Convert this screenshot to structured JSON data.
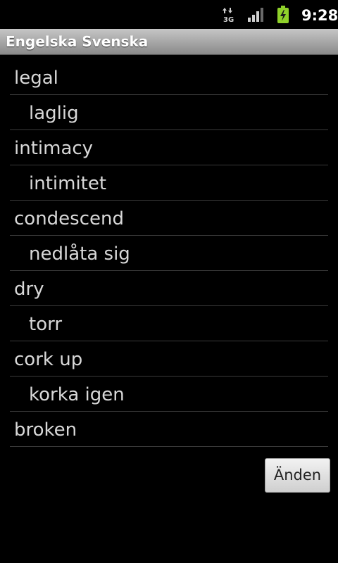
{
  "status_bar": {
    "network_label": "3G",
    "network_icon": "3g-data-icon",
    "signal_icon": "signal-strength-icon",
    "battery_icon": "battery-charging-icon",
    "time": "9:28"
  },
  "title_bar": {
    "title": "Engelska Svenska"
  },
  "word_list": {
    "items": [
      {
        "text": "legal",
        "lang": "en"
      },
      {
        "text": "laglig",
        "lang": "sv"
      },
      {
        "text": "intimacy",
        "lang": "en"
      },
      {
        "text": "intimitet",
        "lang": "sv"
      },
      {
        "text": "condescend",
        "lang": "en"
      },
      {
        "text": "nedlåta sig",
        "lang": "sv"
      },
      {
        "text": "dry",
        "lang": "en"
      },
      {
        "text": "torr",
        "lang": "sv"
      },
      {
        "text": "cork up",
        "lang": "en"
      },
      {
        "text": "korka igen",
        "lang": "sv"
      },
      {
        "text": "broken",
        "lang": "en"
      }
    ]
  },
  "actions": {
    "end_label": "Änden"
  }
}
